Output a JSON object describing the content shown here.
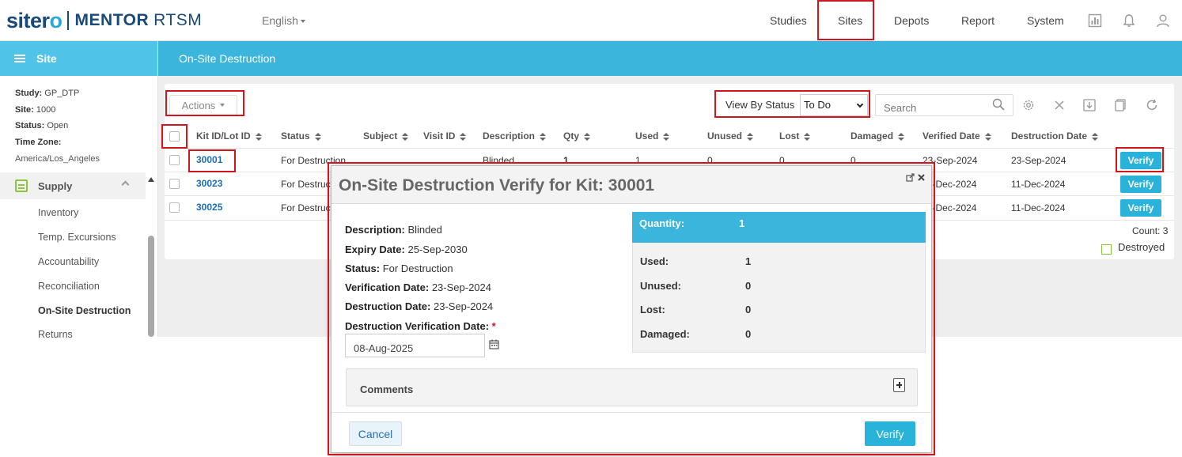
{
  "brand": {
    "sitero_prefix": "siter",
    "sitero_o": "o",
    "mentor": "MENTOR",
    "rtsm": "RTSM"
  },
  "header": {
    "language": "English",
    "nav": [
      "Studies",
      "Sites",
      "Depots",
      "Report",
      "System"
    ],
    "icons": [
      "report-chart-icon",
      "bell-icon",
      "user-icon"
    ]
  },
  "sidebar": {
    "title": "Site",
    "study_label": "Study:",
    "study_value": "GP_DTP",
    "site_label": "Site:",
    "site_value": "1000",
    "status_label": "Status:",
    "status_value": "Open",
    "timezone_label": "Time Zone:",
    "timezone_value": "America/Los_Angeles",
    "section": "Supply",
    "items": [
      "Inventory",
      "Temp. Excursions",
      "Accountability",
      "Reconciliation",
      "On-Site Destruction",
      "Returns"
    ],
    "active_item": "On-Site Destruction"
  },
  "main": {
    "title": "On-Site Destruction",
    "actions_label": "Actions",
    "view_by_status_label": "View By Status",
    "view_by_status_value": "To Do",
    "search_placeholder": "Search",
    "columns": [
      "Kit ID/Lot ID",
      "Status",
      "Subject",
      "Visit ID",
      "Description",
      "Qty",
      "Used",
      "Unused",
      "Lost",
      "Damaged",
      "Verified Date",
      "Destruction Date"
    ],
    "rows": [
      {
        "kit": "30001",
        "status": "For Destruction",
        "description": "Blinded",
        "qty": "1",
        "used": "1",
        "unused": "0",
        "lost": "0",
        "damaged": "0",
        "verified": "23-Sep-2024",
        "destruction": "23-Sep-2024",
        "action": "Verify"
      },
      {
        "kit": "30023",
        "status": "For Destruction",
        "verified": "11-Dec-2024",
        "destruction": "11-Dec-2024",
        "action": "Verify"
      },
      {
        "kit": "30025",
        "status": "For Destruction",
        "verified": "11-Dec-2024",
        "destruction": "11-Dec-2024",
        "action": "Verify"
      }
    ],
    "count_text": "Count: 3",
    "legend_label": "Destroyed"
  },
  "modal": {
    "title": "On-Site Destruction Verify for Kit: 30001",
    "description_label": "Description:",
    "description_value": "Blinded",
    "expiry_label": "Expiry Date:",
    "expiry_value": "25-Sep-2030",
    "status_label": "Status:",
    "status_value": "For Destruction",
    "verification_label": "Verification Date:",
    "verification_value": "23-Sep-2024",
    "destruction_label": "Destruction Date:",
    "destruction_value": "23-Sep-2024",
    "dv_date_label": "Destruction Verification Date:",
    "dv_date_required": "*",
    "dv_date_value": "08-Aug-2025",
    "quantity_label": "Quantity:",
    "quantity_value": "1",
    "used_label": "Used:",
    "used_value": "1",
    "unused_label": "Unused:",
    "unused_value": "0",
    "lost_label": "Lost:",
    "lost_value": "0",
    "damaged_label": "Damaged:",
    "damaged_value": "0",
    "comments_label": "Comments",
    "cancel_label": "Cancel",
    "verify_label": "Verify"
  },
  "colors": {
    "accent": "#3bb5dc",
    "sidebar_head": "#4fc3e8",
    "highlight": "#d0161d",
    "link": "#1b6fb5",
    "legend": "#8cc63f"
  }
}
